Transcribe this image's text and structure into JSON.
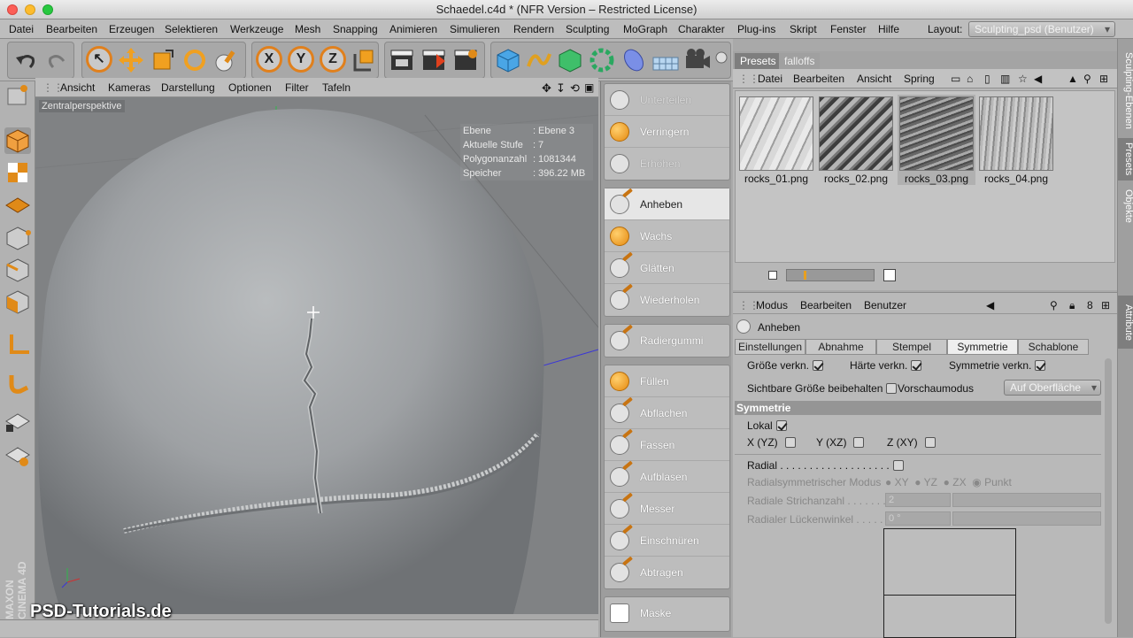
{
  "window": {
    "title": "Schaedel.c4d * (NFR Version – Restricted License)"
  },
  "menubar": {
    "items": [
      "Datei",
      "Bearbeiten",
      "Erzeugen",
      "Selektieren",
      "Werkzeuge",
      "Mesh",
      "Snapping",
      "Animieren",
      "Simulieren",
      "Rendern",
      "Sculpting",
      "MoGraph",
      "Charakter",
      "Plug-ins",
      "Skript",
      "Fenster",
      "Hilfe"
    ],
    "layout_label": "Layout:",
    "layout_value": "Sculpting_psd (Benutzer)"
  },
  "toolbar": {
    "axis_x": "X",
    "axis_y": "Y",
    "axis_z": "Z"
  },
  "viewport": {
    "menu": [
      "Ansicht",
      "Kameras",
      "Darstellung",
      "Optionen",
      "Filter",
      "Tafeln"
    ],
    "label": "Zentralperspektive",
    "hud": [
      {
        "key": "Ebene",
        "value": "Ebene 3"
      },
      {
        "key": "Aktuelle Stufe",
        "value": "7"
      },
      {
        "key": "Polygonanzahl",
        "value": "1081344"
      },
      {
        "key": "Speicher",
        "value": "396.22 MB"
      }
    ]
  },
  "brushes": {
    "group1": [
      {
        "label": "Unterteilen",
        "state": "disabled"
      },
      {
        "label": "Verringern",
        "state": "normal"
      },
      {
        "label": "Erhöhen",
        "state": "disabled"
      }
    ],
    "group2": [
      {
        "label": "Anheben",
        "state": "selected"
      },
      {
        "label": "Wachs",
        "state": "normal"
      },
      {
        "label": "Glätten",
        "state": "normal"
      },
      {
        "label": "Wiederholen",
        "state": "normal"
      }
    ],
    "group3": [
      {
        "label": "Radiergummi",
        "state": "normal"
      }
    ],
    "group4": [
      {
        "label": "Füllen",
        "state": "normal"
      },
      {
        "label": "Abflachen",
        "state": "normal"
      },
      {
        "label": "Fassen",
        "state": "normal"
      },
      {
        "label": "Aufblasen",
        "state": "normal"
      },
      {
        "label": "Messer",
        "state": "normal"
      },
      {
        "label": "Einschnüren",
        "state": "normal"
      },
      {
        "label": "Abtragen",
        "state": "normal"
      }
    ],
    "group5": [
      {
        "label": "Maske",
        "state": "normal"
      }
    ]
  },
  "presets": {
    "tabs": [
      "Presets",
      "falloffs"
    ],
    "menu": [
      "Datei",
      "Bearbeiten",
      "Ansicht",
      "Spring"
    ],
    "thumbnails": [
      {
        "name": "rocks_01.png",
        "selected": false
      },
      {
        "name": "rocks_02.png",
        "selected": false
      },
      {
        "name": "rocks_03.png",
        "selected": true
      },
      {
        "name": "rocks_04.png",
        "selected": false
      }
    ],
    "slider_level": 0.2
  },
  "attributes": {
    "menu": [
      "Modus",
      "Bearbeiten",
      "Benutzer"
    ],
    "tool_name": "Anheben",
    "tabs": [
      "Einstellungen",
      "Abnahme",
      "Stempel",
      "Symmetrie",
      "Schablone"
    ],
    "active_tab": "Symmetrie",
    "groesse_verkn": "Größe verkn.",
    "haerte_verkn": "Härte verkn.",
    "symmetrie_verkn": "Symmetrie verkn.",
    "sichtbare_groesse": "Sichtbare Größe beibehalten",
    "vorschaumodus_label": "Vorschaumodus",
    "vorschaumodus_value": "Auf Oberfläche",
    "section_title": "Symmetrie",
    "lokal": "Lokal",
    "x_yz": "X (YZ)",
    "y_xz": "Y (XZ)",
    "z_xy": "Z (XY)",
    "radial": "Radial . . . . . . . . . . . . . . . . . . .",
    "radial_modus": "Radialsymmetrischer Modus",
    "radial_options": [
      "XY",
      "YZ",
      "ZX",
      "Punkt"
    ],
    "strichanzahl_label": "Radiale Strichanzahl . . . . . . .",
    "strichanzahl_value": "2",
    "lueckenwinkel_label": "Radialer Lückenwinkel . . . . . .",
    "lueckenwinkel_value": "0 °"
  },
  "sidetabs": [
    "Sculpting-Ebenen",
    "Presets",
    "Objekte",
    "Attribute"
  ],
  "watermark": "PSD-Tutorials.de",
  "brand": "MAXON CINEMA 4D",
  "colors": {
    "accent": "#e0801d",
    "viewport_bg": "#808284",
    "selected_tab": "#eeeeee"
  }
}
